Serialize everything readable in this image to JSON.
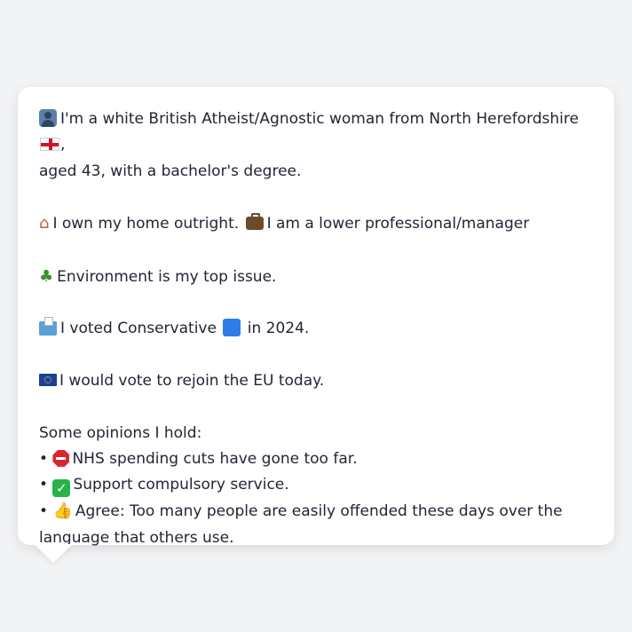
{
  "profile": {
    "line1_a": "I'm a white British Atheist/Agnostic woman from North Herefordshire",
    "line1_b": ",",
    "line1_c": "aged 43, with a bachelor's degree.",
    "home_text": "I own my home outright.",
    "job_text": "I am a lower professional/manager",
    "issue_text": "Environment is my top issue.",
    "vote_a": "I voted Conservative",
    "vote_b": "in 2024.",
    "eu_text": "I would vote to rejoin the EU today.",
    "opinions_heading": "Some opinions I hold:",
    "bullet": "•",
    "opinions": [
      "NHS spending cuts have gone too far.",
      "Support compulsory service.",
      "Agree: Too many people are easily offended these days over the",
      "language that others use."
    ]
  },
  "icons": {
    "person": "person-icon",
    "england_flag": "england-flag-icon",
    "house": "house-icon",
    "briefcase": "briefcase-icon",
    "tree": "tree-icon",
    "ballot": "ballot-box-icon",
    "party_square": "blue-square-icon",
    "eu_flag": "eu-flag-icon",
    "stop": "stop-sign-icon",
    "check": "check-mark-icon",
    "thumbs_up": "thumbs-up-icon"
  },
  "colors": {
    "background": "#f2f3f5",
    "card": "#ffffff",
    "text": "#1f2433",
    "party_blue": "#2f7be8"
  }
}
